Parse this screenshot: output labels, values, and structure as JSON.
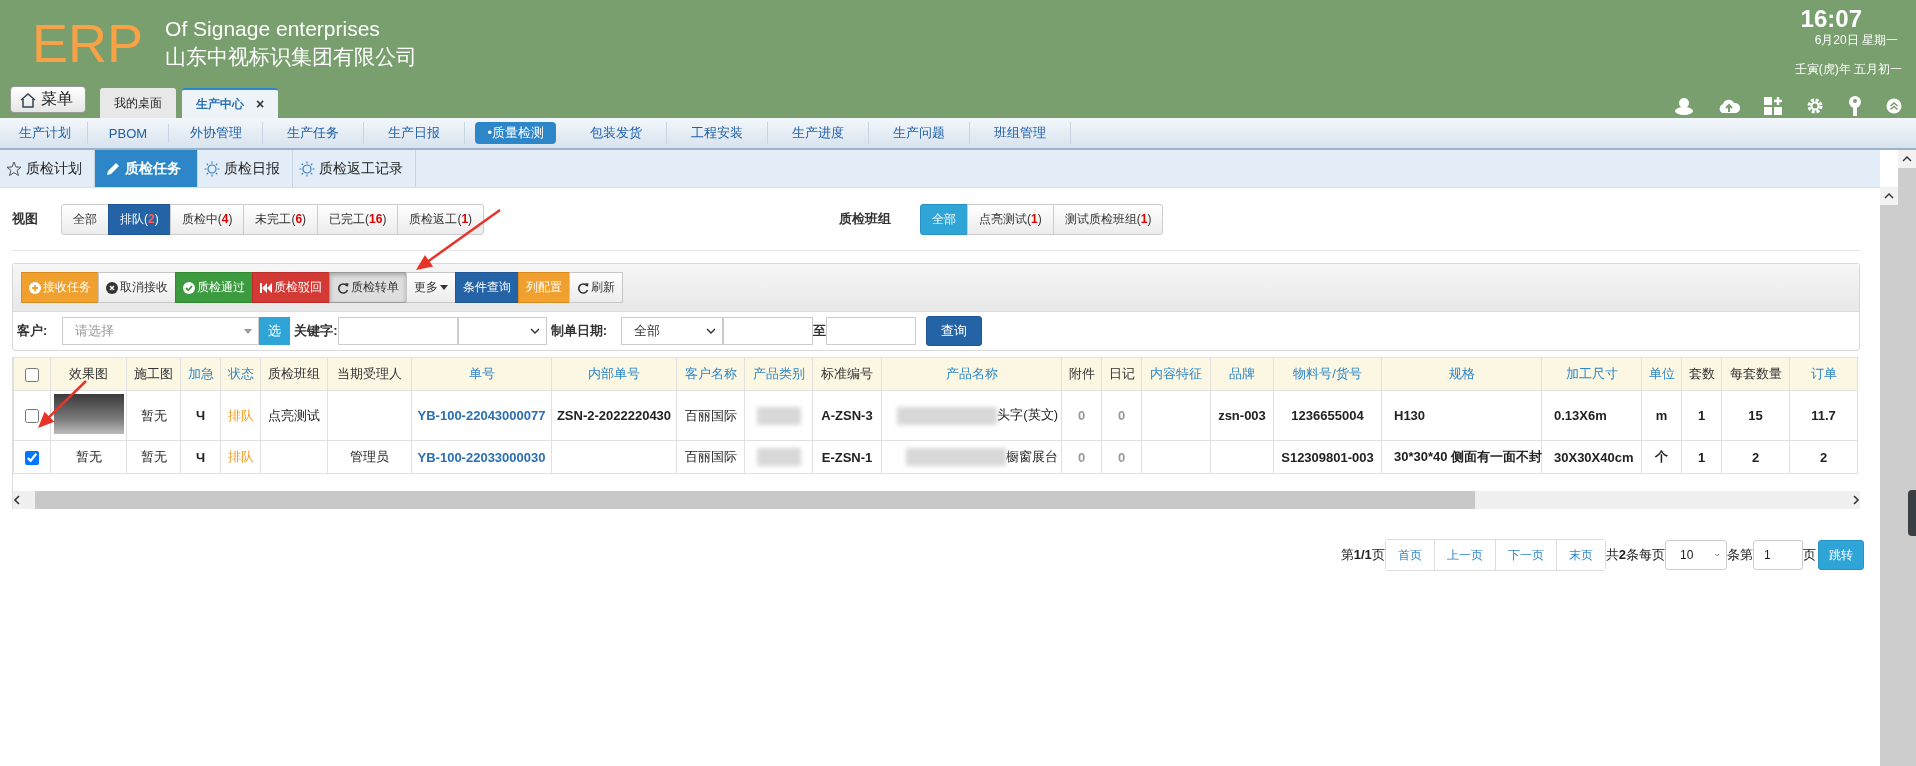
{
  "header": {
    "logo": "ERP",
    "title": "Of Signage enterprises",
    "subtitle": "山东中视标识集团有限公司",
    "time": "16:07",
    "date": "6月20日 星期一",
    "lunar": "壬寅(虎)年 五月初一",
    "menu_button": "菜单",
    "tabs": [
      {
        "label": "我的桌面",
        "selected": false
      },
      {
        "label": "生产中心",
        "selected": true,
        "close": "×"
      }
    ]
  },
  "nav": [
    {
      "label": "生产计划",
      "selected": false
    },
    {
      "label": "PBOM",
      "selected": false
    },
    {
      "label": "外协管理",
      "selected": false
    },
    {
      "label": "生产任务",
      "selected": false
    },
    {
      "label": "生产日报",
      "selected": false
    },
    {
      "label": "•质量检测",
      "selected": true
    },
    {
      "label": "包装发货",
      "selected": false
    },
    {
      "label": "工程安装",
      "selected": false
    },
    {
      "label": "生产进度",
      "selected": false
    },
    {
      "label": "生产问题",
      "selected": false
    },
    {
      "label": "班组管理",
      "selected": false
    }
  ],
  "subtabs": [
    {
      "label": "质检计划",
      "selected": false
    },
    {
      "label": "质检任务",
      "selected": true
    },
    {
      "label": "质检日报",
      "selected": false
    },
    {
      "label": "质检返工记录",
      "selected": false
    }
  ],
  "view": {
    "label": "视图",
    "options": [
      {
        "label": "全部",
        "selected": false
      },
      {
        "label": "排队(**2**)",
        "selected": true
      },
      {
        "label": "质检中(**4**)",
        "selected": false
      },
      {
        "label": "未完工(**6**)",
        "selected": false
      },
      {
        "label": "已完工(**16**)",
        "selected": false
      },
      {
        "label": "质检返工(**1**)",
        "selected": false
      }
    ]
  },
  "team": {
    "label": "质检班组",
    "options": [
      {
        "label": "全部",
        "selected": true
      },
      {
        "label": "点亮测试(**1**)",
        "selected": false
      },
      {
        "label": "测试质检班组(**1**)",
        "selected": false
      }
    ]
  },
  "toolbar": [
    {
      "label": "接收任务",
      "kind": "warning"
    },
    {
      "label": "取消接收",
      "kind": "default"
    },
    {
      "label": "质检通过",
      "kind": "success"
    },
    {
      "label": "质检驳回",
      "kind": "danger"
    },
    {
      "label": "质检转单",
      "kind": "active"
    },
    {
      "label": "更多",
      "kind": "dropdown"
    },
    {
      "label": "条件查询",
      "kind": "primary"
    },
    {
      "label": "列配置",
      "kind": "warning"
    },
    {
      "label": "刷新",
      "kind": "default"
    }
  ],
  "filters": {
    "customer": {
      "label": "客户:",
      "placeholder": "请选择",
      "pick_button": "选"
    },
    "keyword": {
      "label": "关键字:"
    },
    "date": {
      "label": "制单日期:",
      "range": "全部",
      "to_label": "至"
    },
    "query_button": "查询"
  },
  "table": {
    "all_checked": false,
    "columns": [
      {
        "label": "效果图",
        "sortable": false,
        "kind": "plain"
      },
      {
        "label": "施工图",
        "sortable": false,
        "kind": "plain"
      },
      {
        "label": "加急",
        "sortable": true,
        "kind": "bold"
      },
      {
        "label": "状态",
        "sortable": true,
        "kind": "status"
      },
      {
        "label": "质检班组",
        "sortable": false,
        "kind": "plain"
      },
      {
        "label": "当期受理人",
        "sortable": false,
        "kind": "plain"
      },
      {
        "label": "单号",
        "sortable": true,
        "kind": "link"
      },
      {
        "label": "内部单号",
        "sortable": true,
        "kind": "bold"
      },
      {
        "label": "客户名称",
        "sortable": true,
        "kind": "plain"
      },
      {
        "label": "产品类别",
        "sortable": true,
        "kind": "plain"
      },
      {
        "label": "标准编号",
        "sortable": false,
        "kind": "bold"
      },
      {
        "label": "产品名称",
        "sortable": true,
        "kind": "right"
      },
      {
        "label": "附件",
        "sortable": false,
        "kind": "muted"
      },
      {
        "label": "日记",
        "sortable": false,
        "kind": "muted"
      },
      {
        "label": "内容特征",
        "sortable": true,
        "kind": "plain"
      },
      {
        "label": "品牌",
        "sortable": true,
        "kind": "bold"
      },
      {
        "label": "物料号/货号",
        "sortable": true,
        "kind": "bold"
      },
      {
        "label": "规格",
        "sortable": true,
        "kind": "bold-left"
      },
      {
        "label": "加工尺寸",
        "sortable": true,
        "kind": "bold-left"
      },
      {
        "label": "单位",
        "sortable": true,
        "kind": "bold"
      },
      {
        "label": "套数",
        "sortable": false,
        "kind": "bold"
      },
      {
        "label": "每套数量",
        "sortable": false,
        "kind": "bold"
      },
      {
        "label": "订单",
        "sortable": true,
        "kind": "bold"
      }
    ],
    "rows": [
      {
        "checked": false,
        "cells": [
          {
            "kind": "photo"
          },
          "暂无",
          "Ч",
          "排队",
          "点亮测试",
          null,
          "YB-100-22043000077",
          "ZSN-2-2022220430",
          "百丽国际",
          {
            "kind": "blurred"
          },
          "A-ZSN-3",
          {
            "kind": "blurred",
            "text": "头字(英文)"
          },
          "0",
          "0",
          null,
          "zsn-003",
          "1236655004",
          "H130",
          "0.13X6m",
          "m",
          "1",
          "15",
          "11.7"
        ]
      },
      {
        "checked": true,
        "cells": [
          "暂无",
          "暂无",
          "Ч",
          "排队",
          null,
          "管理员",
          "YB-100-22033000030",
          null,
          "百丽国际",
          {
            "kind": "blurred"
          },
          "E-ZSN-1",
          {
            "kind": "blurred",
            "text": "橱窗展台"
          },
          "0",
          "0",
          null,
          null,
          "S12309801-003",
          "30*30*40 侧面有一面不封",
          "30X30X40cm",
          "个",
          "1",
          "2",
          "2"
        ]
      }
    ]
  },
  "pager": {
    "page_info": "第**1/1**页",
    "buttons": [
      "首页",
      "上一页",
      "下一页",
      "末页"
    ],
    "total": "共**2**条每页",
    "page_size": "10",
    "page_label": "条第",
    "page": "1",
    "page_suffix": "页",
    "go_button": "跳转"
  }
}
